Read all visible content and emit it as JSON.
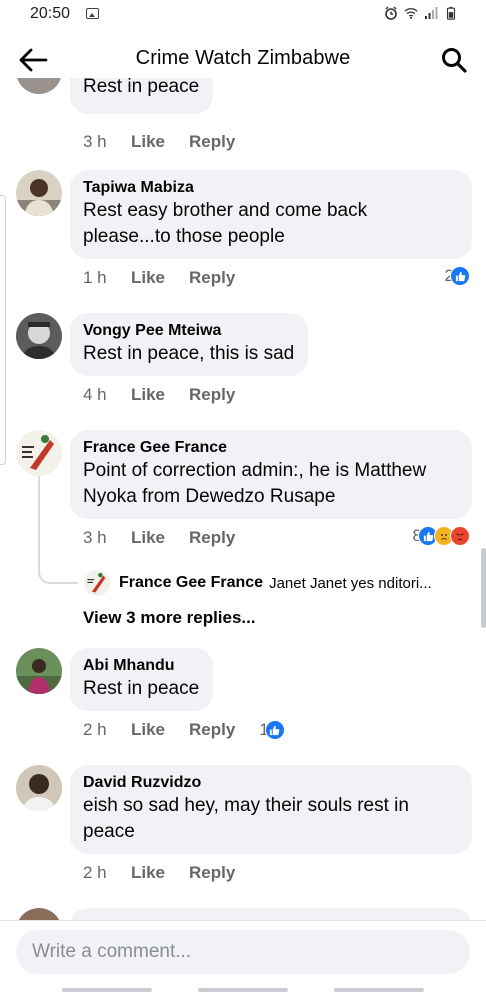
{
  "status_bar": {
    "time": "20:50"
  },
  "header": {
    "title": "Crime Watch Zimbabwe"
  },
  "comments": [
    {
      "text": "Rest in peace",
      "time": "3 h",
      "like": "Like",
      "reply": "Reply"
    },
    {
      "author": "Tapiwa Mabiza",
      "text_line1": "Rest easy brother and come back",
      "text_line2": "please...to those people",
      "time": "1 h",
      "like": "Like",
      "reply": "Reply",
      "reaction_count": "2"
    },
    {
      "author": "Vongy Pee Mteiwa",
      "text": "Rest in peace, this is sad",
      "time": "4 h",
      "like": "Like",
      "reply": "Reply"
    },
    {
      "author": "France Gee France",
      "text_line1": "Point of correction admin:, he is Matthew",
      "text_line2": "Nyoka from Dewedzo Rusape",
      "time": "3 h",
      "like": "Like",
      "reply": "Reply",
      "reaction_count": "8",
      "reply_preview": {
        "author": "France Gee France",
        "text": "Janet Janet yes nditori..."
      },
      "more_replies": "View 3 more replies..."
    },
    {
      "author": "Abi Mhandu",
      "text": "Rest in peace",
      "time": "2 h",
      "like": "Like",
      "reply": "Reply",
      "reaction_count": "1"
    },
    {
      "author": "David Ruzvidzo",
      "text_line1": "eish so sad hey, may their souls rest in",
      "text_line2": "peace",
      "time": "2 h",
      "like": "Like",
      "reply": "Reply"
    }
  ],
  "composer": {
    "placeholder": "Write a comment..."
  },
  "colors": {
    "bubble": "#f0f2f5",
    "like_blue": "#1877f2",
    "sad_yellow": "#f7b125",
    "angry_red": "#e8452c",
    "meta_gray": "#65676b"
  }
}
